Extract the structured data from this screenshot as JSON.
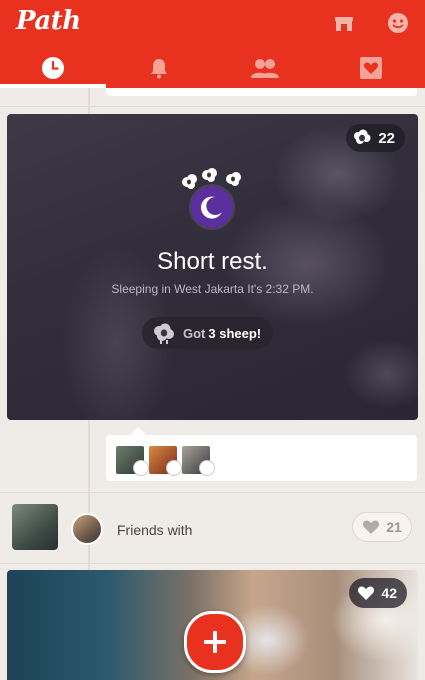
{
  "header": {
    "app_name": "Path",
    "accent": "#e8321f",
    "shop_icon": "shop-icon",
    "emoji_icon": "smiley-icon",
    "tabs": [
      {
        "icon": "clock-icon",
        "active": true
      },
      {
        "icon": "bell-icon",
        "active": false
      },
      {
        "icon": "friends-icon",
        "active": false
      },
      {
        "icon": "heart-square-icon",
        "active": false
      }
    ]
  },
  "sleep_moment": {
    "sheep_count_badge": "22",
    "title": "Short rest.",
    "subtitle": "Sleeping in West Jakarta It's 2:32 PM.",
    "got_label": "Got",
    "sheep_amount": "3 sheep!"
  },
  "friends_row": {
    "text": "Friends with",
    "likes": "21"
  },
  "photo_moment": {
    "likes": "42"
  },
  "fab": {
    "icon": "plus-icon"
  }
}
